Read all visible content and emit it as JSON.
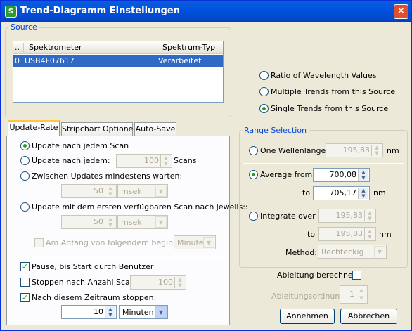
{
  "window": {
    "title": "Trend-Diagramm Einstellungen",
    "app_icon_text": "S",
    "close_glyph": "✕"
  },
  "source": {
    "title": "Source",
    "columns": [
      "..",
      "Spektrometer",
      "Spektrum-Typ"
    ],
    "rows": [
      {
        "index": "0",
        "spektrometer": "USB4F07617",
        "typ": "Verarbeitet",
        "selected": true
      }
    ]
  },
  "mode": {
    "options": [
      "Ratio of Wavelength Values",
      "Multiple Trends from this Source",
      "Single Trends from this Source"
    ],
    "selected": 2
  },
  "tabs": [
    "Update-Rate",
    "Stripchart Optionen",
    "Auto-Save"
  ],
  "update_rate": {
    "opt_each_scan": "Update nach jedem Scan",
    "opt_every": "Update nach jedem:",
    "every_value": "100",
    "every_unit": "Scans",
    "opt_min_wait": "Zwischen Updates mindestens warten:",
    "min_wait_value": "50",
    "min_wait_unit": "msek",
    "opt_first_available": "Update mit dem ersten verfügbaren Scan nach jeweils::",
    "first_value": "50",
    "first_unit": "msek",
    "start_at_label": "Am Anfang von folgendem beginnen:",
    "start_at_unit": "Minute",
    "pause_label": "Pause, bis Start durch Benutzer",
    "pause_checked": true,
    "stop_scans_label": "Stoppen nach Anzahl Scans:",
    "stop_scans_checked": false,
    "stop_scans_value": "100",
    "stop_time_label": "Nach diesem Zeitraum stoppen:",
    "stop_time_checked": true,
    "stop_time_value": "10",
    "stop_time_unit": "Minuten",
    "selected": 0
  },
  "range": {
    "title": "Range Selection",
    "opt_one": "One Wellenlänge:",
    "one_value": "195,83",
    "nm": "nm",
    "opt_average": "Average from",
    "avg_from": "700,08",
    "to_label": "to",
    "avg_to": "705,17",
    "opt_integrate": "Integrate over",
    "int_from": "195,83",
    "int_to": "195,83",
    "method_label": "Method:",
    "method_value": "Rechteckig",
    "selected": 1
  },
  "derivative": {
    "label": "Ableitung berechnen:",
    "checked": false,
    "order_label": "Ableitungsordnung:",
    "order_value": "1"
  },
  "buttons": {
    "ok": "Annehmen",
    "cancel": "Abbrechen"
  },
  "glyphs": {
    "up": "▲",
    "down": "▼",
    "check": "✓"
  }
}
